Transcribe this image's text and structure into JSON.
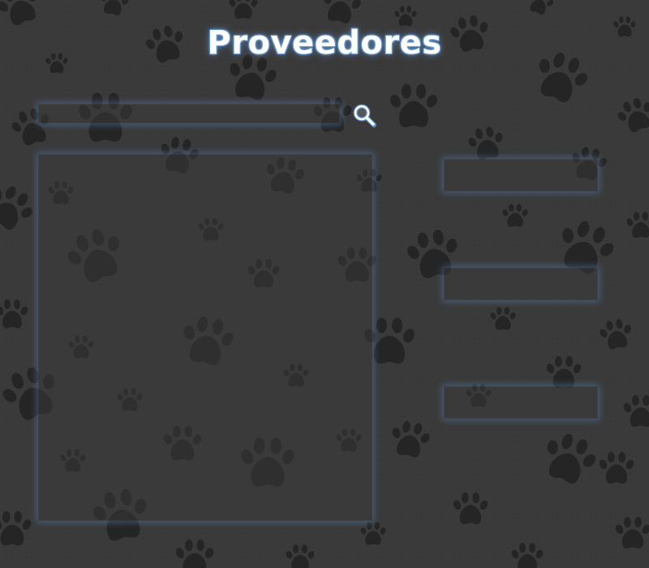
{
  "page": {
    "title": "Proveedores",
    "background_color": "#3a3a3a",
    "paw_color": "#1e1e1e",
    "glow_color": "#5d8fcb"
  },
  "search": {
    "value": "",
    "placeholder": "",
    "icon": "magnifier-icon"
  },
  "list": {
    "items": []
  },
  "fields": [
    {
      "value": ""
    },
    {
      "value": ""
    },
    {
      "value": ""
    }
  ]
}
